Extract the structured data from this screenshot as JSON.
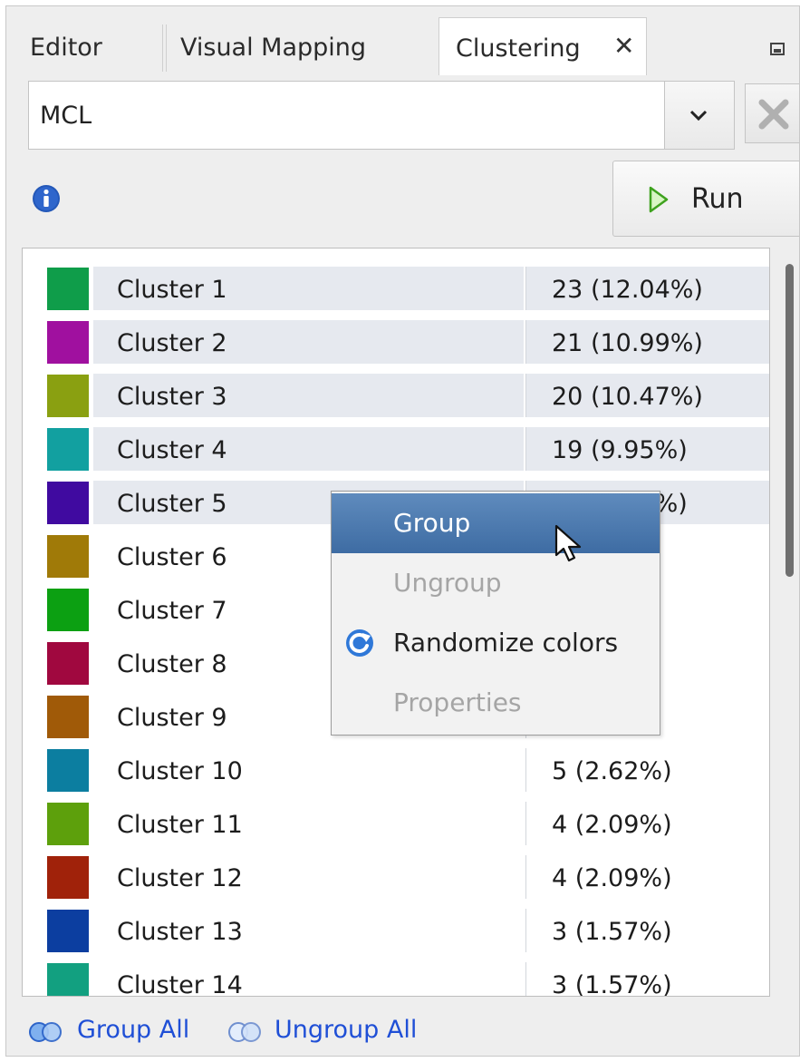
{
  "tabs": [
    {
      "label": "Editor"
    },
    {
      "label": "Visual Mapping"
    },
    {
      "label": "Clustering",
      "active": true
    }
  ],
  "algorithm": {
    "selected": "MCL"
  },
  "run_button": {
    "label": "Run"
  },
  "clusters": [
    {
      "name": "Cluster 1",
      "size": "23 (12.04%)",
      "color": "#0f9d4a",
      "selected": true
    },
    {
      "name": "Cluster 2",
      "size": "21 (10.99%)",
      "color": "#a0109f",
      "selected": true
    },
    {
      "name": "Cluster 3",
      "size": "20 (10.47%)",
      "color": "#8aa011",
      "selected": true
    },
    {
      "name": "Cluster 4",
      "size": "19 (9.95%)",
      "color": "#12a0a0",
      "selected": true
    },
    {
      "name": "Cluster 5",
      "size": "18 (9.42%)",
      "color": "#400aa0",
      "selected": true
    },
    {
      "name": "Cluster 6",
      "size": "",
      "color": "#a07a08",
      "selected": false
    },
    {
      "name": "Cluster 7",
      "size": "",
      "color": "#0ca012",
      "selected": false
    },
    {
      "name": "Cluster 8",
      "size": "",
      "color": "#a0083f",
      "selected": false
    },
    {
      "name": "Cluster 9",
      "size": "",
      "color": "#a05a08",
      "selected": false
    },
    {
      "name": "Cluster 10",
      "size": "5 (2.62%)",
      "color": "#0c7ea0",
      "selected": false
    },
    {
      "name": "Cluster 11",
      "size": "4 (2.09%)",
      "color": "#5da00c",
      "selected": false
    },
    {
      "name": "Cluster 12",
      "size": "4 (2.09%)",
      "color": "#a0220a",
      "selected": false
    },
    {
      "name": "Cluster 13",
      "size": "3 (1.57%)",
      "color": "#0c3ea0",
      "selected": false
    },
    {
      "name": "Cluster 14",
      "size": "3 (1.57%)",
      "color": "#12a080",
      "selected": false
    }
  ],
  "context_menu": {
    "items": [
      {
        "label": "Group",
        "state": "highlighted"
      },
      {
        "label": "Ungroup",
        "state": "disabled"
      },
      {
        "label": "Randomize colors",
        "state": "enabled",
        "icon": "refresh-icon"
      },
      {
        "label": "Properties",
        "state": "disabled"
      }
    ]
  },
  "footer": {
    "group_all": "Group All",
    "ungroup_all": "Ungroup All"
  },
  "colors": {
    "selection_row": "#e6e9ef",
    "menu_highlight": "#4a78ad",
    "link": "#1f4fd6"
  }
}
